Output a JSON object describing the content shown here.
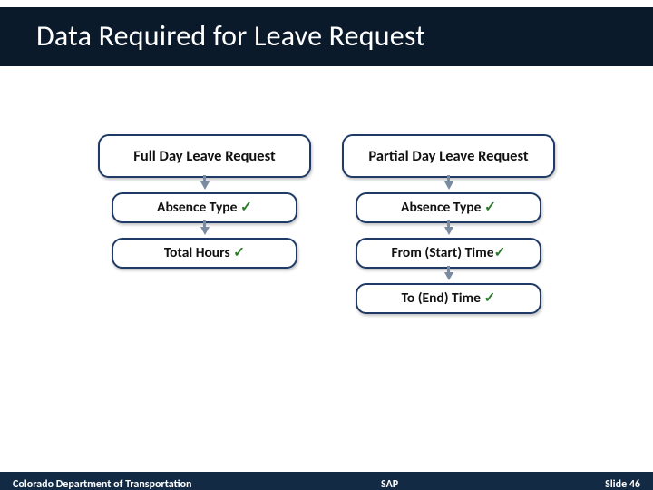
{
  "title": "Data Required for Leave Request",
  "columns": {
    "left": {
      "header": "Full Day Leave Request",
      "steps": [
        {
          "label": "Absence Type ",
          "check": "✓"
        },
        {
          "label": "Total Hours ",
          "check": "✓"
        }
      ]
    },
    "right": {
      "header": "Partial Day Leave Request",
      "steps": [
        {
          "label": "Absence Type ",
          "check": "✓"
        },
        {
          "label": "From (Start) Time",
          "check": "✓"
        },
        {
          "label": "To (End) Time ",
          "check": "✓"
        }
      ]
    }
  },
  "footer": {
    "org": "Colorado Department of Transportation",
    "system": "SAP",
    "slide_label": "Slide 46"
  }
}
